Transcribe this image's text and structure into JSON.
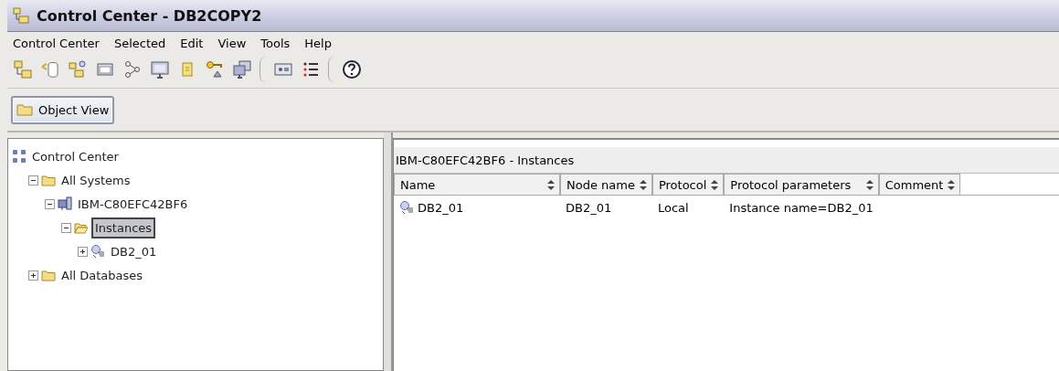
{
  "window": {
    "title": "Control Center - DB2COPY2"
  },
  "menu": [
    "Control Center",
    "Selected",
    "Edit",
    "View",
    "Tools",
    "Help"
  ],
  "toolbar": [
    {
      "kind": "tree"
    },
    {
      "kind": "cylinder"
    },
    {
      "kind": "people"
    },
    {
      "kind": "console"
    },
    {
      "kind": "flow"
    },
    {
      "kind": "monitor"
    },
    {
      "kind": "note"
    },
    {
      "kind": "key"
    },
    {
      "kind": "screens"
    },
    {
      "kind": "sep"
    },
    {
      "kind": "panel"
    },
    {
      "kind": "list"
    },
    {
      "kind": "sep"
    },
    {
      "kind": "help"
    }
  ],
  "view_button": {
    "label": "Object View"
  },
  "tree": [
    {
      "label": "Control Center",
      "kind": "root",
      "selected": false,
      "children": [
        {
          "label": "All Systems",
          "kind": "folder",
          "expanded": true,
          "selected": false,
          "children": [
            {
              "label": "IBM-C80EFC42BF6",
              "kind": "computer",
              "expanded": true,
              "selected": false,
              "children": [
                {
                  "label": "Instances",
                  "kind": "openfolder",
                  "expanded": true,
                  "selected": true,
                  "children": [
                    {
                      "label": "DB2_01",
                      "kind": "instance",
                      "expanded": false,
                      "selected": false
                    }
                  ]
                }
              ]
            }
          ]
        },
        {
          "label": "All Databases",
          "kind": "folder",
          "expanded": false,
          "selected": false
        }
      ]
    }
  ],
  "details": {
    "title": "IBM-C80EFC42BF6 - Instances",
    "columns": [
      "Name",
      "Node name",
      "Protocol",
      "Protocol parameters",
      "Comment"
    ],
    "rows": [
      [
        "DB2_01",
        "DB2_01",
        "Local",
        "Instance name=DB2_01",
        ""
      ]
    ]
  }
}
